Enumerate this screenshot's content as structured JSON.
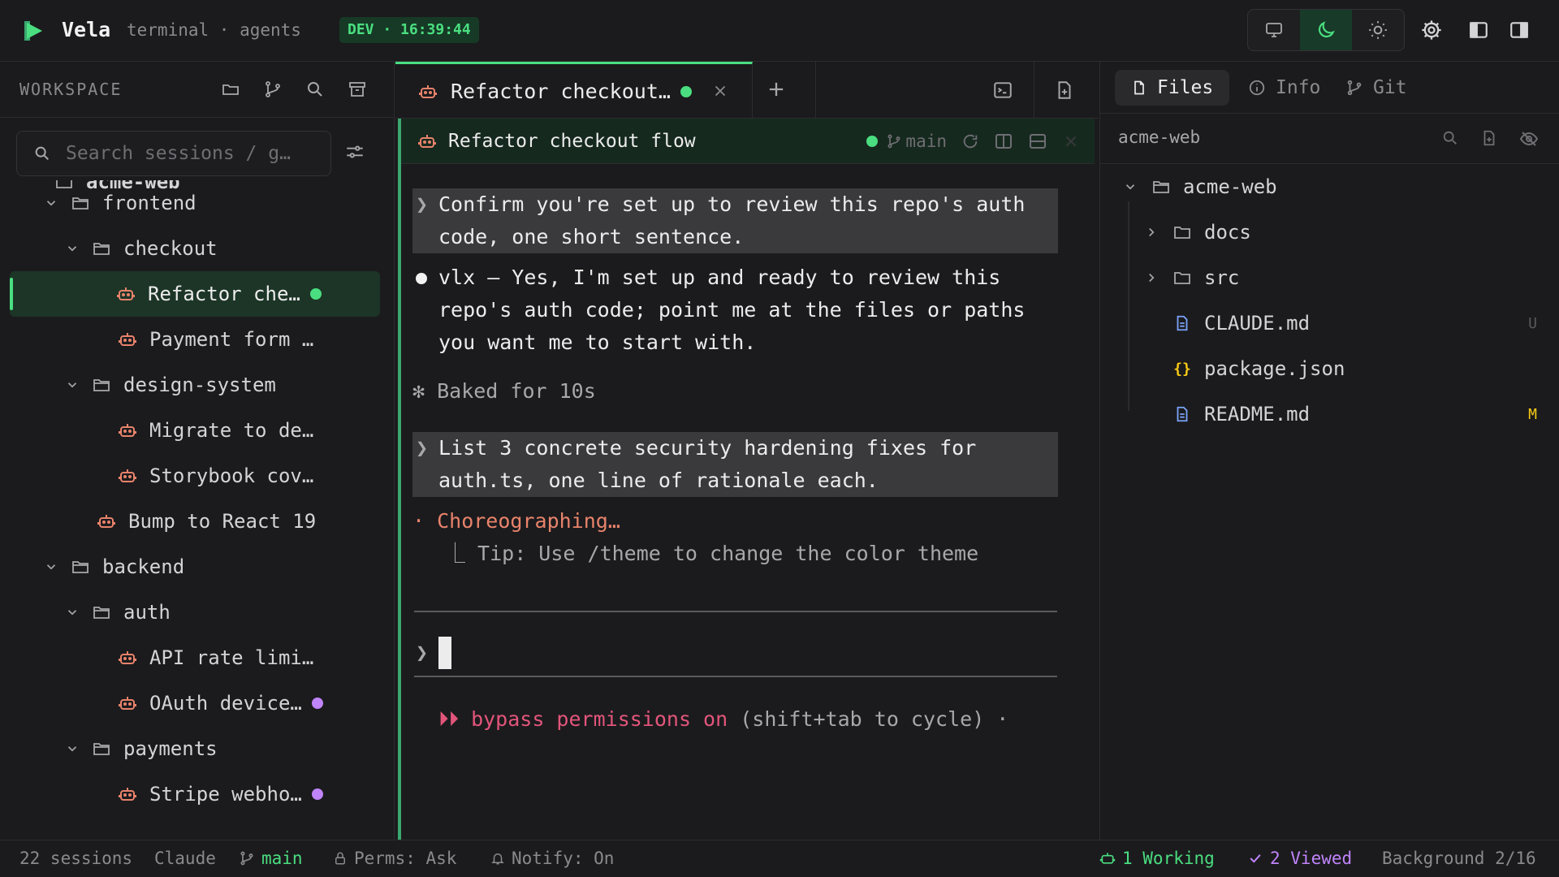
{
  "app": {
    "name": "Vela",
    "subtitle": "terminal · agents",
    "env_badge": "DEV · 16:39:44"
  },
  "colors": {
    "accent": "#4ade80",
    "session_icon": "#e8836b",
    "purple_status": "#c084fc",
    "pink_warning": "#e2557b",
    "modified": "#facc15"
  },
  "toolbar": {
    "theme_options": [
      "monitor-icon",
      "moon-icon",
      "sun-icon"
    ],
    "active_theme": "moon-icon"
  },
  "sidebar": {
    "title": "WORKSPACE",
    "search_placeholder": "Search sessions / g…",
    "tree": [
      {
        "label": "frontend",
        "type": "folder",
        "depth": 1
      },
      {
        "label": "checkout",
        "type": "folder",
        "depth": 2
      },
      {
        "label": "Refactor che…",
        "type": "session",
        "depth": 3,
        "status": "green",
        "active": true
      },
      {
        "label": "Payment form …",
        "type": "session",
        "depth": 3
      },
      {
        "label": "design-system",
        "type": "folder",
        "depth": 2
      },
      {
        "label": "Migrate to de…",
        "type": "session",
        "depth": 3
      },
      {
        "label": "Storybook cov…",
        "type": "session",
        "depth": 3
      },
      {
        "label": "Bump to React 19",
        "type": "session",
        "depth": 2
      },
      {
        "label": "backend",
        "type": "folder",
        "depth": 1
      },
      {
        "label": "auth",
        "type": "folder",
        "depth": 2
      },
      {
        "label": "API rate limi…",
        "type": "session",
        "depth": 3
      },
      {
        "label": "OAuth device…",
        "type": "session",
        "depth": 3,
        "status": "purple"
      },
      {
        "label": "payments",
        "type": "folder",
        "depth": 2
      },
      {
        "label": "Stripe webho…",
        "type": "session",
        "depth": 3,
        "status": "purple"
      }
    ]
  },
  "tabs": {
    "active_label": "Refactor checkout…"
  },
  "pane": {
    "title": "Refactor checkout flow",
    "branch": "main"
  },
  "terminal": {
    "prompt1_line1": "Confirm you're set up to review this repo's auth",
    "prompt1_line2": "code, one short sentence.",
    "resp_line1": "vlx — Yes, I'm set up and ready to review this",
    "resp_line2": "repo's auth code; point me at the files or paths",
    "resp_line3": "you want me to start with.",
    "baked": "✻ Baked for 10s",
    "prompt2_line1": "List 3 concrete security hardening fixes for",
    "prompt2_line2": "auth.ts, one line of rationale each.",
    "working": "· Choreographing…",
    "tip": "⎿  Tip: Use /theme to change the color theme",
    "chevron": "❯",
    "bypass_arrows": "⏵⏵",
    "bypass_label": "bypass permissions on",
    "bypass_hint": "(shift+tab to cycle) ·"
  },
  "right_panel": {
    "tabs": [
      "Files",
      "Info",
      "Git"
    ],
    "active_tab": "Files",
    "root_label": "acme-web",
    "files": [
      {
        "label": "acme-web",
        "type": "folder-open"
      },
      {
        "label": "docs",
        "type": "folder"
      },
      {
        "label": "src",
        "type": "folder"
      },
      {
        "label": "CLAUDE.md",
        "type": "file",
        "badge": "U"
      },
      {
        "label": "package.json",
        "type": "json"
      },
      {
        "label": "README.md",
        "type": "file",
        "badge": "M"
      }
    ]
  },
  "status": {
    "sessions": "22 sessions",
    "agent": "Claude",
    "branch": "main",
    "perms": "Perms: Ask",
    "notify": "Notify: On",
    "working": "1 Working",
    "viewed": "2 Viewed",
    "background": "Background 2/16"
  }
}
